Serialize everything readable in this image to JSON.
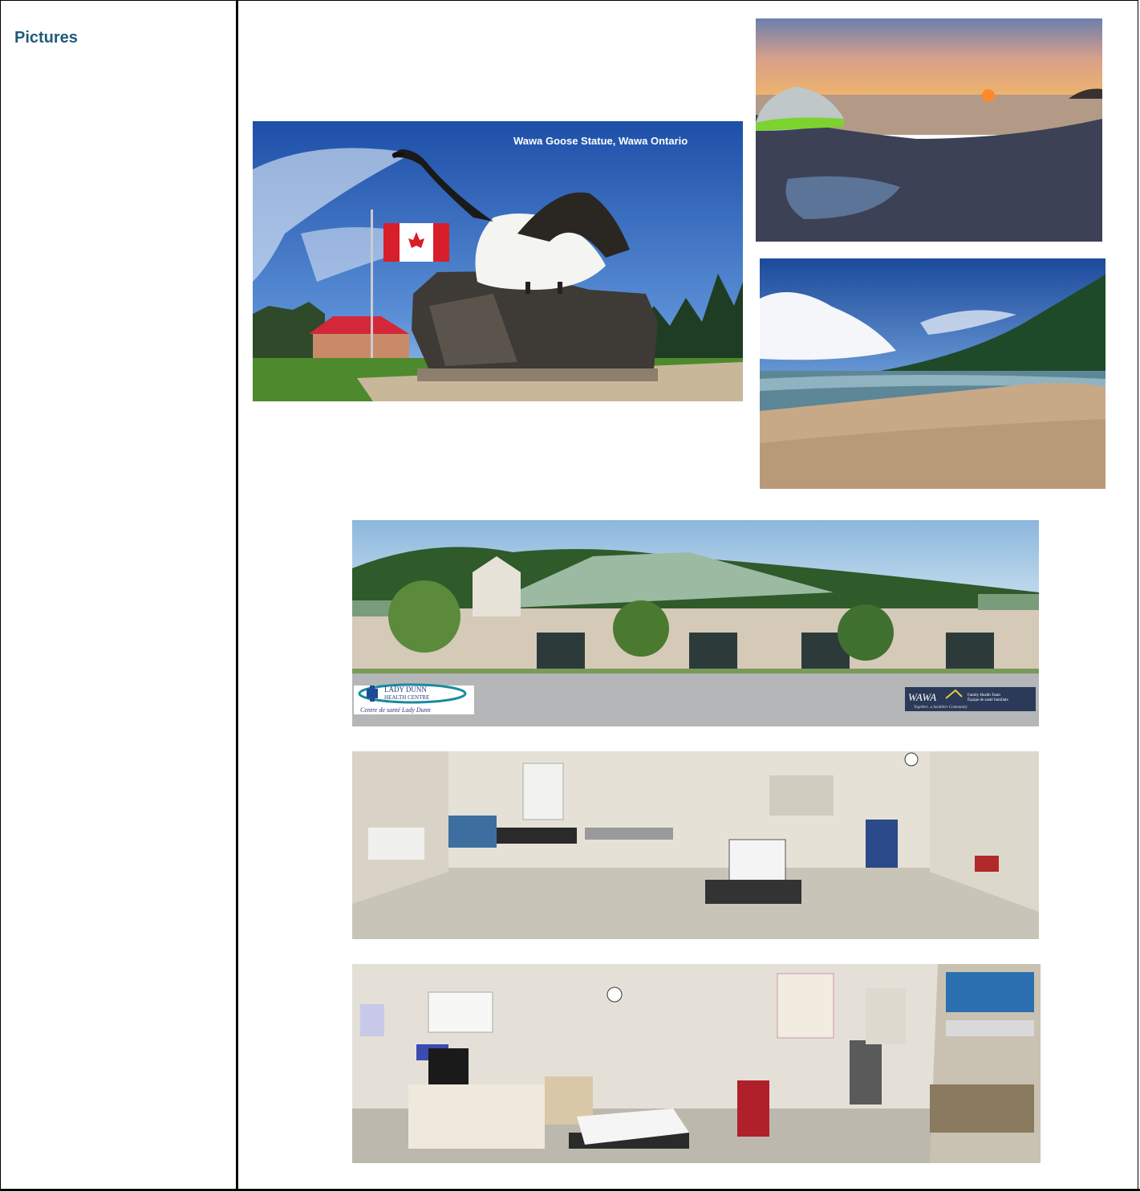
{
  "section_label": "Pictures",
  "goose_photo": {
    "caption": "Wawa Goose Statue, Wawa Ontario"
  },
  "hospital_photo": {
    "left_logo_line1": "LADY DUNN",
    "left_logo_line2": "HEALTH CENTRE",
    "left_logo_sub": "Centre de santé Lady Dunn",
    "right_logo_name": "WAWA",
    "right_logo_line1": "Family Health Team",
    "right_logo_line2": "Équipe de santé familiale",
    "right_logo_tag": "Together...a healthier Community"
  }
}
